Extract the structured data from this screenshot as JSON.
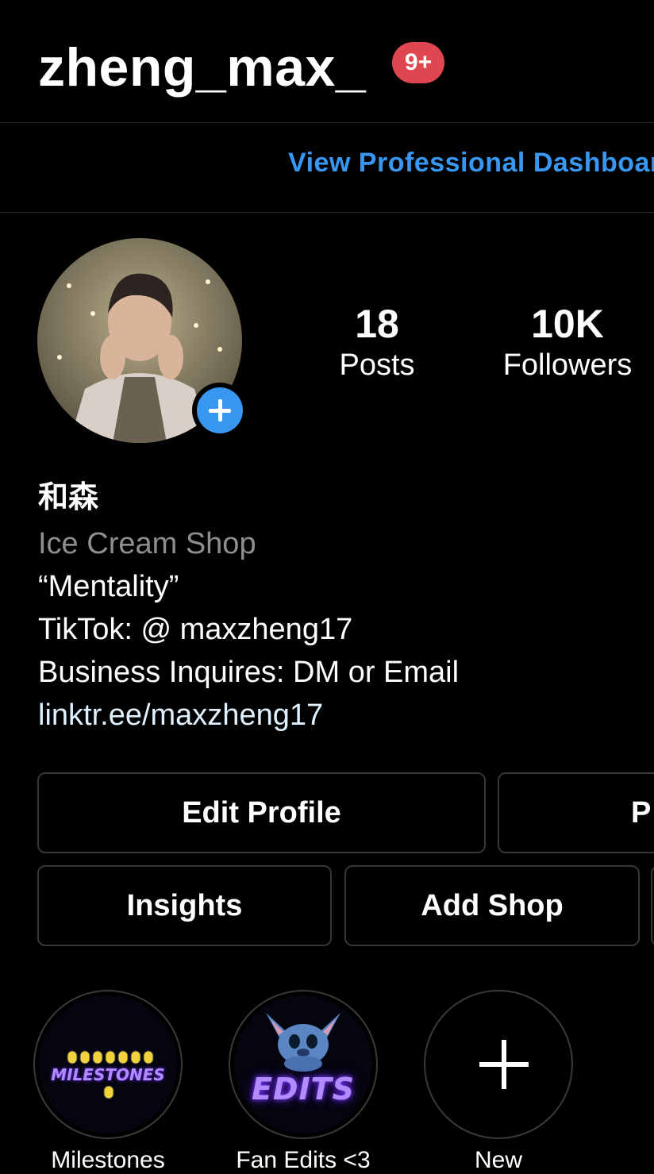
{
  "header": {
    "username": "zheng_max_",
    "notification_badge": "9+",
    "dashboard_link": "View Professional Dashboard"
  },
  "profile": {
    "add_story_icon": "plus-icon",
    "stats": [
      {
        "value": "18",
        "label": "Posts"
      },
      {
        "value": "10K",
        "label": "Followers"
      }
    ]
  },
  "bio": {
    "name": "和森",
    "category": "Ice Cream Shop",
    "lines": [
      "“Mentality”",
      "TikTok: @ maxzheng17",
      "Business Inquires: DM or Email"
    ],
    "link": "linktr.ee/maxzheng17"
  },
  "buttons": {
    "edit_profile": "Edit Profile",
    "promotions": "P",
    "insights": "Insights",
    "add_shop": "Add Shop"
  },
  "highlights": [
    {
      "label": "Milestones",
      "cover_text": "MILESTONES"
    },
    {
      "label": "Fan Edits <3",
      "cover_text": "EDITS"
    },
    {
      "label": "New",
      "icon": "plus-icon"
    }
  ],
  "colors": {
    "accent_blue": "#3897f0",
    "badge_red": "#e0464f",
    "muted": "#8e8e8e",
    "border": "#363636"
  }
}
